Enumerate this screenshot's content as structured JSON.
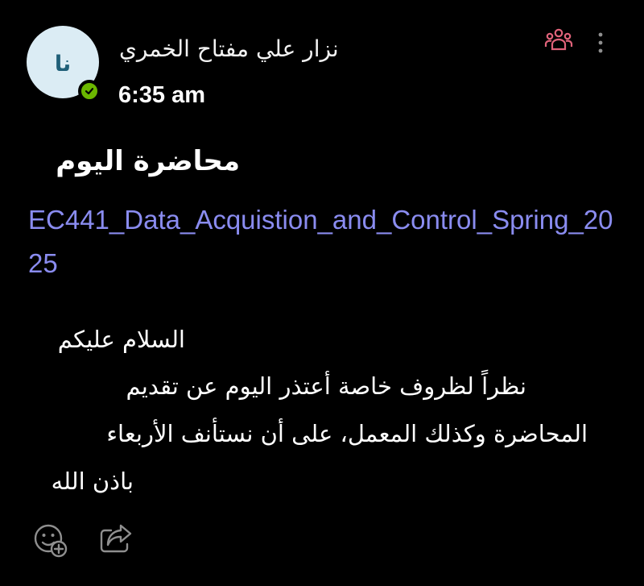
{
  "message": {
    "author_initials": "نا",
    "author_name": "نزار علي مفتاح الخمري",
    "time": "6:35 am",
    "subject": "محاضرة اليوم",
    "channel_link": "EC441_Data_Acquistion_and_Control_Spring_2025",
    "greeting": "السلام عليكم",
    "body_lines": [
      "نظراً لظروف خاصة أعتذر اليوم عن تقديم",
      "المحاضرة وكذلك المعمل، على أن نستأنف الأربعاء",
      "باذن الله"
    ]
  },
  "icons": {
    "presence": "available-check-icon",
    "people": "people-icon",
    "more": "more-vertical-icon",
    "react": "add-reaction-icon",
    "share": "share-icon"
  },
  "colors": {
    "background": "#000000",
    "link": "#8a8cf0",
    "people_icon": "#e0637a",
    "presence": "#6bb700",
    "avatar_bg": "#dbecf4",
    "avatar_text": "#1f5f78",
    "muted_icon": "#8f8f8f"
  }
}
